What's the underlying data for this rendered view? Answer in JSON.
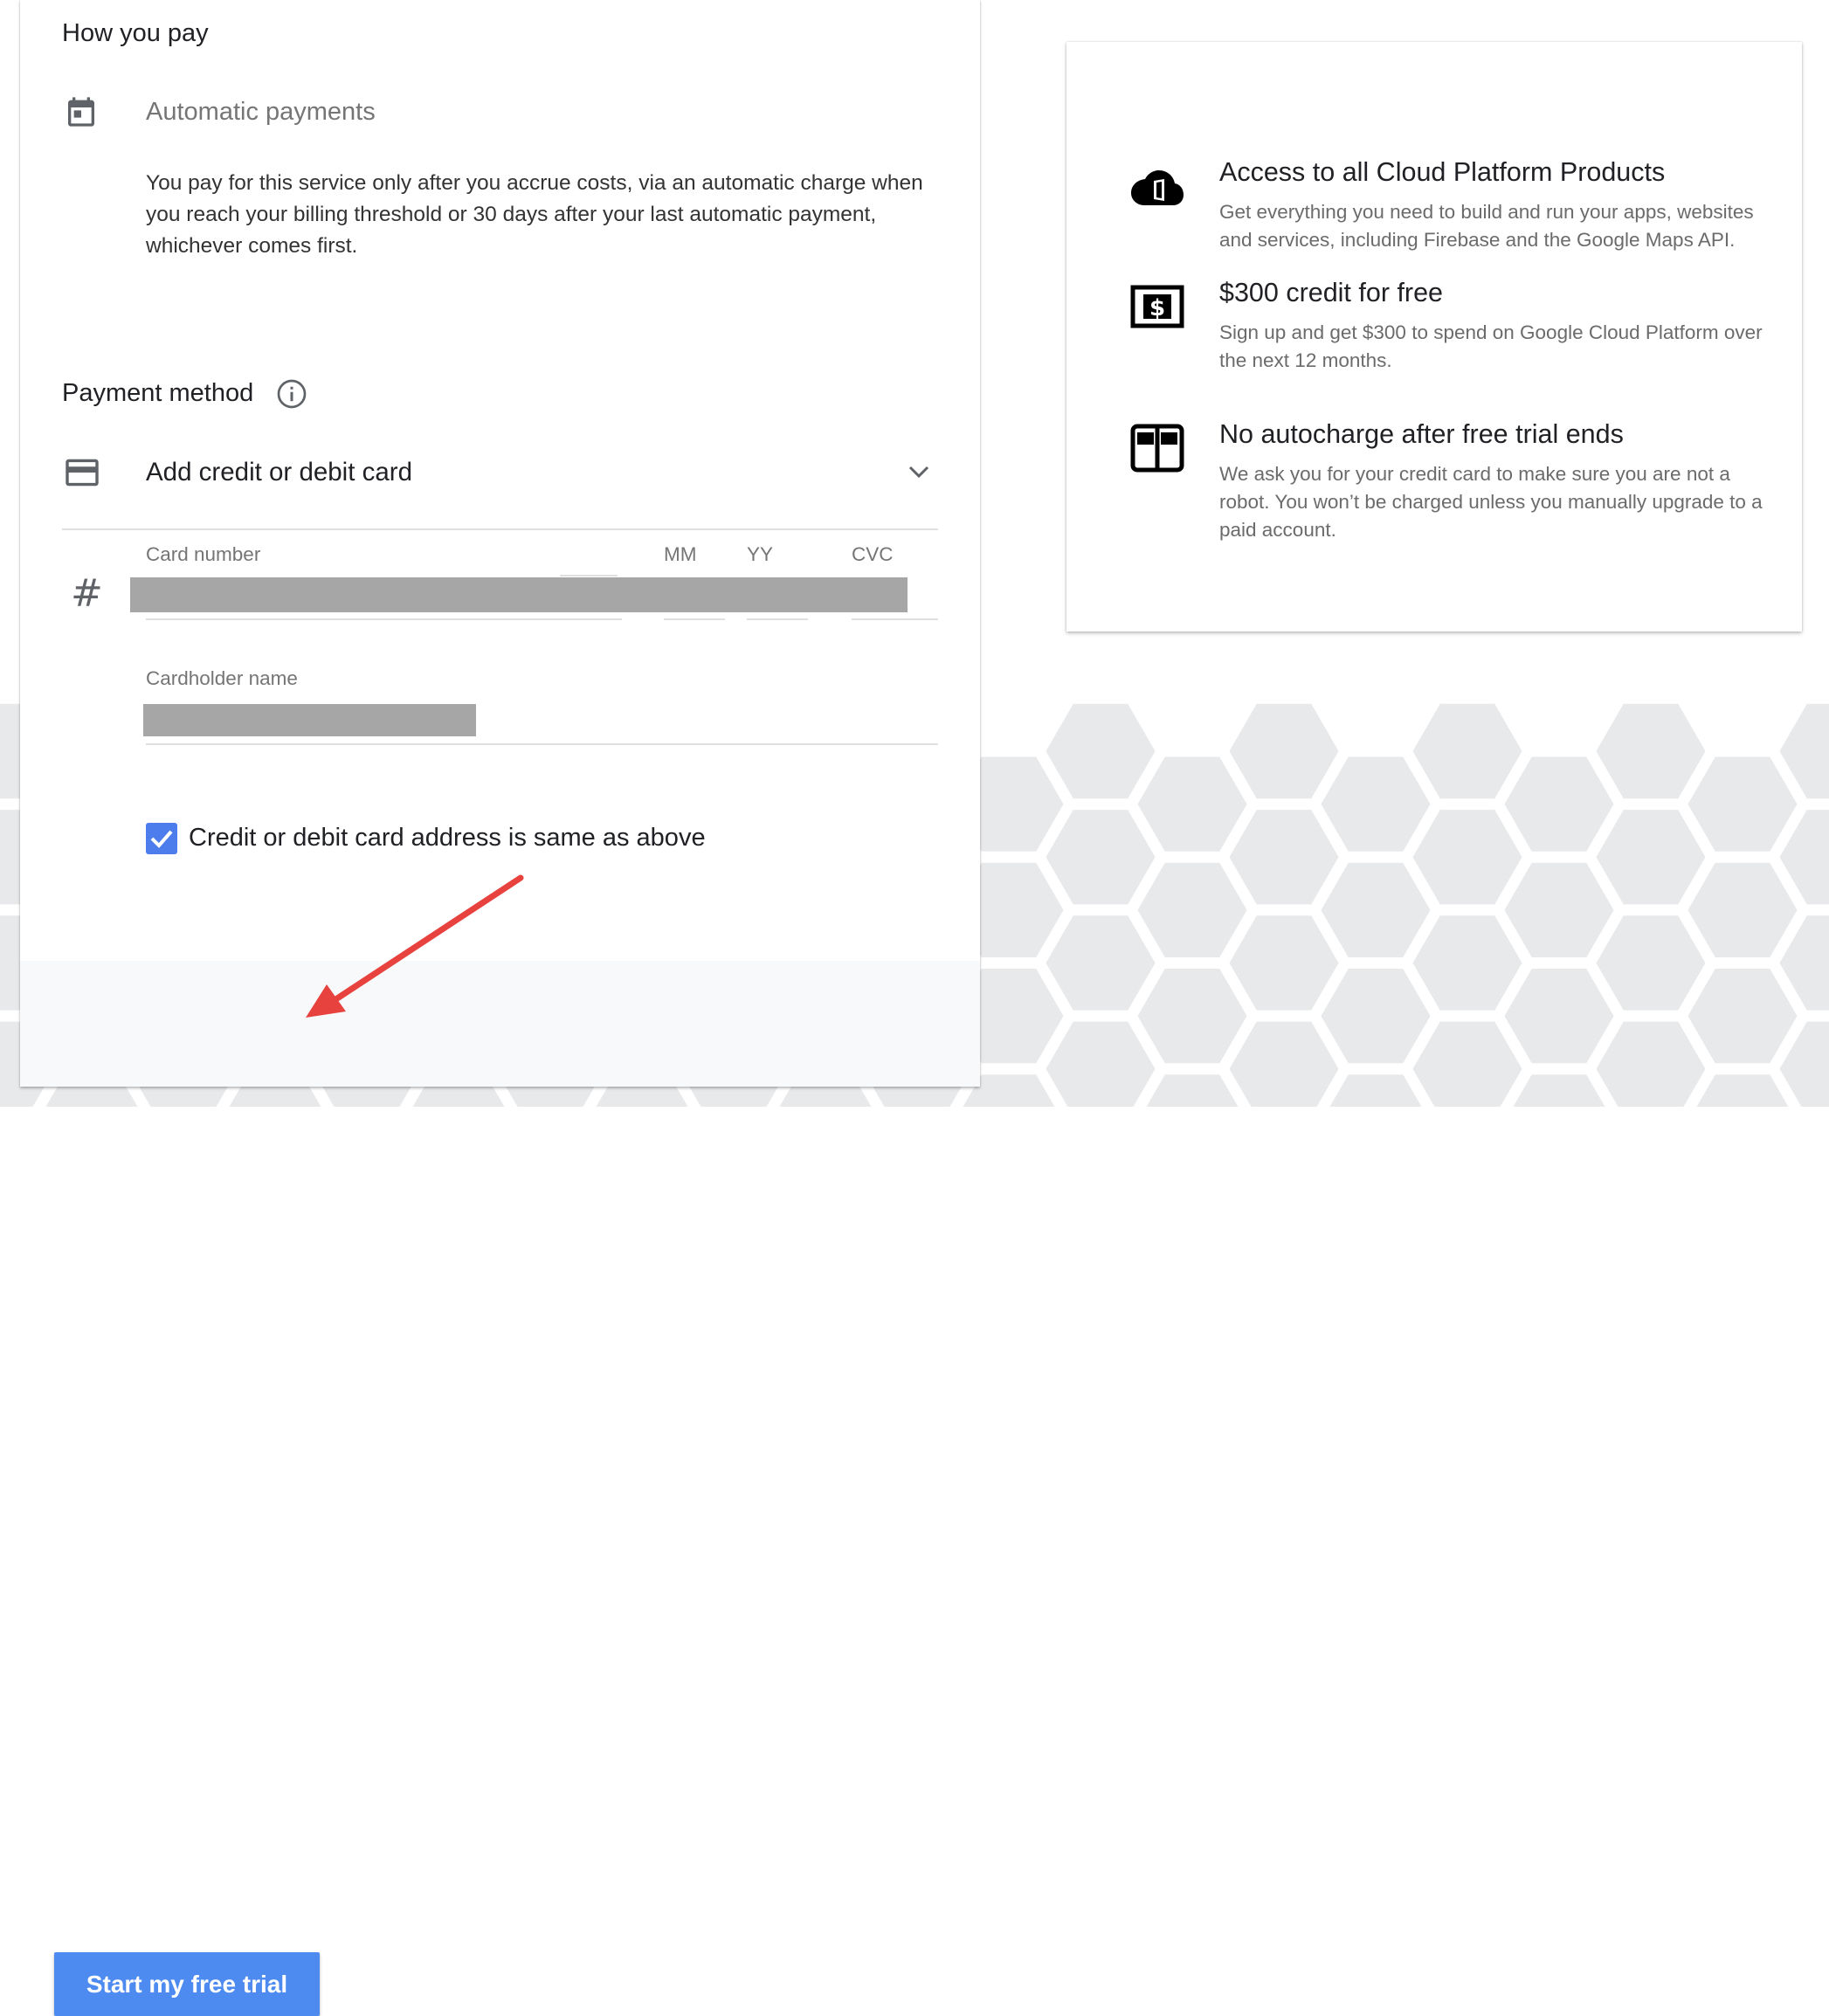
{
  "how_you_pay": {
    "title": "How you pay",
    "method_label": "Automatic payments",
    "description": "You pay for this service only after you accrue costs, via an automatic charge when you reach your billing threshold or 30 days after your last automatic payment, whichever comes first."
  },
  "payment_method": {
    "title": "Payment method",
    "add_card_label": "Add credit or debit card",
    "fields": {
      "card_number_label": "Card number",
      "mm_label": "MM",
      "yy_label": "YY",
      "cvc_label": "CVC",
      "cardholder_label": "Cardholder name"
    },
    "address_checkbox": {
      "label": "Credit or debit card address is same as above",
      "checked": true
    }
  },
  "actions": {
    "start_trial_label": "Start my free trial"
  },
  "benefits": [
    {
      "icon": "cloud-icon",
      "title": "Access to all Cloud Platform Products",
      "description": "Get everything you need to build and run your apps, websites and services, including Firebase and the Google Maps API."
    },
    {
      "icon": "dollar-bill-icon",
      "title": "$300 credit for free",
      "description": "Sign up and get $300 to spend on Google Cloud Platform over the next 12 months."
    },
    {
      "icon": "no-autocharge-icon",
      "title": "No autocharge after free trial ends",
      "description": "We ask you for your credit card to make sure you are not a robot. You won’t be charged unless you manually upgrade to a paid account."
    }
  ],
  "colors": {
    "primary_button": "#4d8bf0",
    "checkbox": "#4d7ded",
    "annotation_arrow": "#e8423f",
    "hex_pattern": "#e8e9eb"
  }
}
